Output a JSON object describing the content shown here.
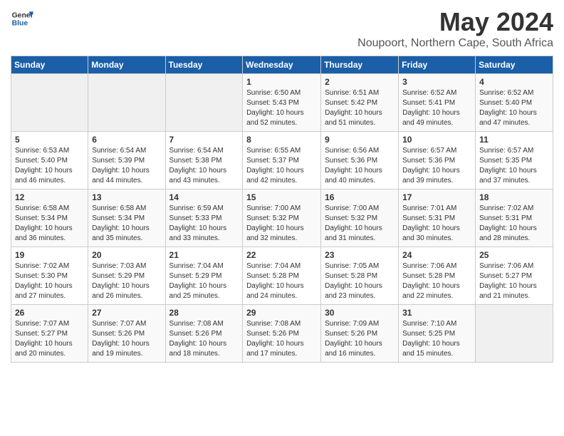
{
  "header": {
    "logo_general": "General",
    "logo_blue": "Blue",
    "month_title": "May 2024",
    "location": "Noupoort, Northern Cape, South Africa"
  },
  "days_of_week": [
    "Sunday",
    "Monday",
    "Tuesday",
    "Wednesday",
    "Thursday",
    "Friday",
    "Saturday"
  ],
  "weeks": [
    [
      {
        "day": "",
        "info": ""
      },
      {
        "day": "",
        "info": ""
      },
      {
        "day": "",
        "info": ""
      },
      {
        "day": "1",
        "info": "Sunrise: 6:50 AM\nSunset: 5:43 PM\nDaylight: 10 hours and 52 minutes."
      },
      {
        "day": "2",
        "info": "Sunrise: 6:51 AM\nSunset: 5:42 PM\nDaylight: 10 hours and 51 minutes."
      },
      {
        "day": "3",
        "info": "Sunrise: 6:52 AM\nSunset: 5:41 PM\nDaylight: 10 hours and 49 minutes."
      },
      {
        "day": "4",
        "info": "Sunrise: 6:52 AM\nSunset: 5:40 PM\nDaylight: 10 hours and 47 minutes."
      }
    ],
    [
      {
        "day": "5",
        "info": "Sunrise: 6:53 AM\nSunset: 5:40 PM\nDaylight: 10 hours and 46 minutes."
      },
      {
        "day": "6",
        "info": "Sunrise: 6:54 AM\nSunset: 5:39 PM\nDaylight: 10 hours and 44 minutes."
      },
      {
        "day": "7",
        "info": "Sunrise: 6:54 AM\nSunset: 5:38 PM\nDaylight: 10 hours and 43 minutes."
      },
      {
        "day": "8",
        "info": "Sunrise: 6:55 AM\nSunset: 5:37 PM\nDaylight: 10 hours and 42 minutes."
      },
      {
        "day": "9",
        "info": "Sunrise: 6:56 AM\nSunset: 5:36 PM\nDaylight: 10 hours and 40 minutes."
      },
      {
        "day": "10",
        "info": "Sunrise: 6:57 AM\nSunset: 5:36 PM\nDaylight: 10 hours and 39 minutes."
      },
      {
        "day": "11",
        "info": "Sunrise: 6:57 AM\nSunset: 5:35 PM\nDaylight: 10 hours and 37 minutes."
      }
    ],
    [
      {
        "day": "12",
        "info": "Sunrise: 6:58 AM\nSunset: 5:34 PM\nDaylight: 10 hours and 36 minutes."
      },
      {
        "day": "13",
        "info": "Sunrise: 6:58 AM\nSunset: 5:34 PM\nDaylight: 10 hours and 35 minutes."
      },
      {
        "day": "14",
        "info": "Sunrise: 6:59 AM\nSunset: 5:33 PM\nDaylight: 10 hours and 33 minutes."
      },
      {
        "day": "15",
        "info": "Sunrise: 7:00 AM\nSunset: 5:32 PM\nDaylight: 10 hours and 32 minutes."
      },
      {
        "day": "16",
        "info": "Sunrise: 7:00 AM\nSunset: 5:32 PM\nDaylight: 10 hours and 31 minutes."
      },
      {
        "day": "17",
        "info": "Sunrise: 7:01 AM\nSunset: 5:31 PM\nDaylight: 10 hours and 30 minutes."
      },
      {
        "day": "18",
        "info": "Sunrise: 7:02 AM\nSunset: 5:31 PM\nDaylight: 10 hours and 28 minutes."
      }
    ],
    [
      {
        "day": "19",
        "info": "Sunrise: 7:02 AM\nSunset: 5:30 PM\nDaylight: 10 hours and 27 minutes."
      },
      {
        "day": "20",
        "info": "Sunrise: 7:03 AM\nSunset: 5:29 PM\nDaylight: 10 hours and 26 minutes."
      },
      {
        "day": "21",
        "info": "Sunrise: 7:04 AM\nSunset: 5:29 PM\nDaylight: 10 hours and 25 minutes."
      },
      {
        "day": "22",
        "info": "Sunrise: 7:04 AM\nSunset: 5:28 PM\nDaylight: 10 hours and 24 minutes."
      },
      {
        "day": "23",
        "info": "Sunrise: 7:05 AM\nSunset: 5:28 PM\nDaylight: 10 hours and 23 minutes."
      },
      {
        "day": "24",
        "info": "Sunrise: 7:06 AM\nSunset: 5:28 PM\nDaylight: 10 hours and 22 minutes."
      },
      {
        "day": "25",
        "info": "Sunrise: 7:06 AM\nSunset: 5:27 PM\nDaylight: 10 hours and 21 minutes."
      }
    ],
    [
      {
        "day": "26",
        "info": "Sunrise: 7:07 AM\nSunset: 5:27 PM\nDaylight: 10 hours and 20 minutes."
      },
      {
        "day": "27",
        "info": "Sunrise: 7:07 AM\nSunset: 5:26 PM\nDaylight: 10 hours and 19 minutes."
      },
      {
        "day": "28",
        "info": "Sunrise: 7:08 AM\nSunset: 5:26 PM\nDaylight: 10 hours and 18 minutes."
      },
      {
        "day": "29",
        "info": "Sunrise: 7:08 AM\nSunset: 5:26 PM\nDaylight: 10 hours and 17 minutes."
      },
      {
        "day": "30",
        "info": "Sunrise: 7:09 AM\nSunset: 5:26 PM\nDaylight: 10 hours and 16 minutes."
      },
      {
        "day": "31",
        "info": "Sunrise: 7:10 AM\nSunset: 5:25 PM\nDaylight: 10 hours and 15 minutes."
      },
      {
        "day": "",
        "info": ""
      }
    ]
  ]
}
